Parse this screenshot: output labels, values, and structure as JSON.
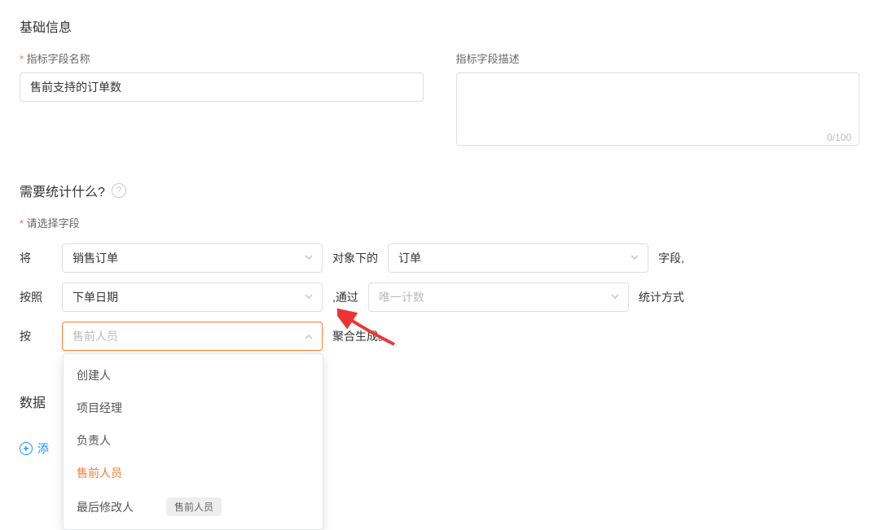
{
  "basic": {
    "section_title": "基础信息",
    "field_name_label": "指标字段名称",
    "field_name_value": "售前支持的订单数",
    "field_desc_label": "指标字段描述",
    "field_desc_value": "",
    "char_count": "0/100"
  },
  "stats": {
    "section_title": "需要统计什么?",
    "field_select_label": "请选择字段",
    "rows": {
      "r1": {
        "label": "将",
        "select1": "销售订单",
        "text1": "对象下的",
        "select2": "订单",
        "text2": "字段,"
      },
      "r2": {
        "label": "按照",
        "select1": "下单日期",
        "text1": ",通过",
        "select2_ph": "唯一计数",
        "text2": "统计方式"
      },
      "r3": {
        "label": "按",
        "select1_ph": "售前人员",
        "text1": "聚合生成。"
      }
    },
    "dropdown": {
      "options": [
        {
          "label": "创建人"
        },
        {
          "label": "项目经理"
        },
        {
          "label": "负责人"
        },
        {
          "label": "售前人员",
          "selected": true
        },
        {
          "label": "最后修改人",
          "badge": "售前人员"
        }
      ]
    }
  },
  "data_section": {
    "title_partial": "数据",
    "add_link": "添"
  }
}
